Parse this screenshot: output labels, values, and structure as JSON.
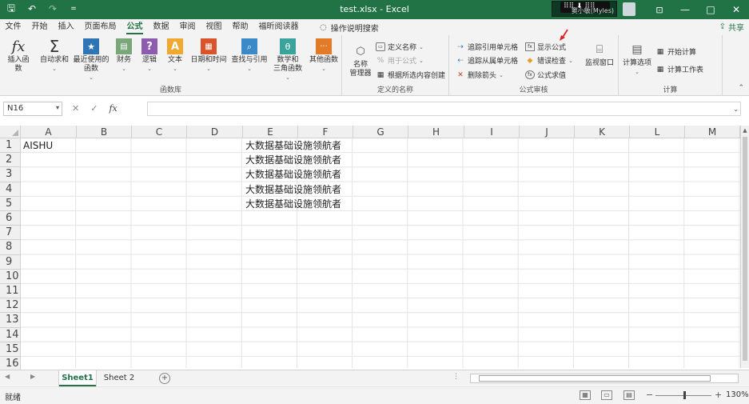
{
  "window": {
    "title": "test.xlsx  -  Excel",
    "username": "窦小敏(Myles)",
    "minimize": "—",
    "maximize": "□",
    "close": "✕"
  },
  "qat": {
    "save": "🖫",
    "undo": "↶",
    "redo": "↷",
    "more": "="
  },
  "menu": {
    "items": [
      "文件",
      "开始",
      "插入",
      "页面布局",
      "公式",
      "数据",
      "审阅",
      "视图",
      "帮助",
      "福昕阅读器"
    ],
    "active_index": 4,
    "tell_me": "操作说明搜索",
    "share": "共享"
  },
  "ribbon": {
    "function_library": {
      "label": "函数库",
      "insert_function": "插入函数",
      "autosum": "自动求和",
      "recent": "最近使用的\n函数",
      "financial": "财务",
      "logical": "逻辑",
      "text": "文本",
      "datetime": "日期和时间",
      "lookup": "查找与引用",
      "math": "数学和\n三角函数",
      "more": "其他函数"
    },
    "defined_names": {
      "label": "定义的名称",
      "name_manager": "名称\n管理器",
      "define_name": "定义名称",
      "use_in_formula": "用于公式",
      "create_from_selection": "根据所选内容创建"
    },
    "formula_auditing": {
      "label": "公式审核",
      "trace_precedents": "追踪引用单元格",
      "trace_dependents": "追踪从属单元格",
      "remove_arrows": "删除箭头",
      "show_formulas": "显示公式",
      "error_checking": "错误检查",
      "evaluate_formula": "公式求值",
      "watch_window": "监视窗口"
    },
    "calculation": {
      "label": "计算",
      "calc_options": "计算选项",
      "calc_now": "开始计算",
      "calc_sheet": "计算工作表"
    }
  },
  "formula_bar": {
    "name_box": "N16",
    "cancel": "✕",
    "enter": "✓",
    "fx": "fx",
    "value": ""
  },
  "grid": {
    "columns": [
      "A",
      "B",
      "C",
      "D",
      "E",
      "F",
      "G",
      "H",
      "I",
      "J",
      "K",
      "L",
      "M"
    ],
    "rows": [
      "1",
      "2",
      "3",
      "4",
      "5",
      "6",
      "7",
      "8",
      "9",
      "10",
      "11",
      "12",
      "13",
      "14",
      "15",
      "16"
    ],
    "cells": {
      "A1": "AISHU",
      "E1": "大数据基础设施领航者",
      "E2": "大数据基础设施领航者",
      "E3": "大数据基础设施领航者",
      "E4": "大数据基础设施领航者",
      "E5": "大数据基础设施领航者"
    }
  },
  "sheets": {
    "tabs": [
      "Sheet1",
      "Sheet 2"
    ],
    "active_index": 0,
    "add": "+"
  },
  "status": {
    "ready": "就绪",
    "zoom": "130%",
    "zoom_minus": "−",
    "zoom_plus": "+"
  },
  "colors": {
    "brand": "#217346",
    "annotation_arrow": "#e02020"
  }
}
